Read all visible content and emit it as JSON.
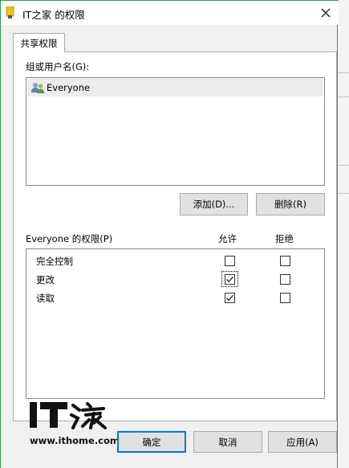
{
  "window": {
    "title": "IT之家 的权限"
  },
  "tabs": [
    {
      "label": "共享权限"
    }
  ],
  "group_section": {
    "label": "组或用户名(G):",
    "users": [
      {
        "name": "Everyone"
      }
    ],
    "add_button": "添加(D)...",
    "remove_button": "删除(R)"
  },
  "perm_section": {
    "label": "Everyone 的权限(P)",
    "allow_header": "允许",
    "deny_header": "拒绝",
    "rows": [
      {
        "name": "完全控制",
        "allow": false,
        "deny": false
      },
      {
        "name": "更改",
        "allow": true,
        "deny": false
      },
      {
        "name": "读取",
        "allow": true,
        "deny": false
      }
    ]
  },
  "footer": {
    "ok": "确定",
    "cancel": "取消",
    "apply": "应用(A)"
  },
  "watermark": {
    "url": "www.ithome.com"
  },
  "colors": {
    "frame": "#2b9b4c",
    "default_button_border": "#0078d7",
    "title_icon": "#f0c419"
  }
}
